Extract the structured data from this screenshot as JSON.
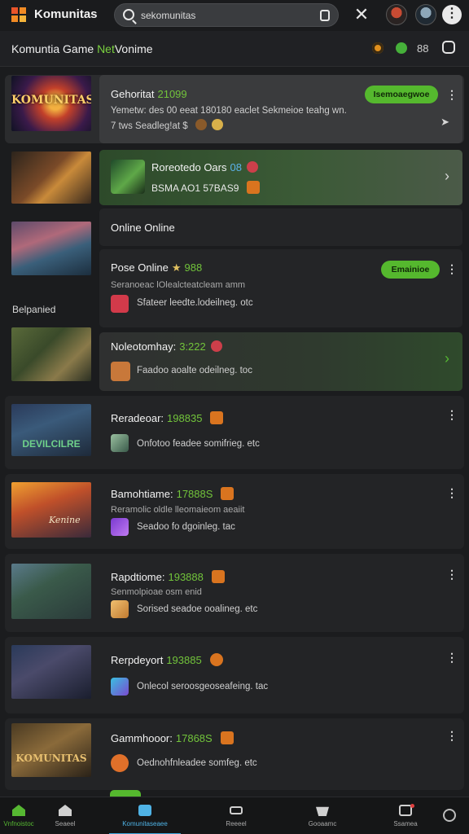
{
  "header": {
    "app_title": "Komunitas",
    "search_value": "sekomunitas",
    "search_placeholder": "Search"
  },
  "subheader": {
    "title_main": "Komuntia Game ",
    "title_accent": "Net",
    "title_rest": "Vonime",
    "count": "88"
  },
  "section_label": "Belpanied",
  "items": [
    {
      "title": "Gehoritat",
      "number": "21099",
      "line1": "Yemetw: des 00 eeat 180180 eaclet Sekmeioe teahg wn.",
      "line2": "7 tws Seadleg!at $ ",
      "thumb_text": "KOMUNITAS",
      "button": "Isemoaegwoe"
    },
    {
      "title": "Roreotedo Oars",
      "number": "08",
      "line1": "BSMA AO1 57BAS9"
    },
    {
      "title": "Online Online"
    },
    {
      "title": "Pose Online",
      "number": "988",
      "line1": "Seranoeac lOlealcteatcleam amm",
      "line2": "Sfateer leedte.lodeilneg. otc",
      "button": "Emainioe"
    },
    {
      "title": "Noleotomhay:",
      "number": "3:222",
      "line1": "Faadoo aoalte odeilneg. toc"
    },
    {
      "title": "Reradeoar:",
      "number": "198835",
      "line1": "Onfotoo feadee somifrieg. etc",
      "thumb_text": "DEVILCILRE"
    },
    {
      "title": "Bamohtiame:",
      "number": "17888S",
      "line1": "Reramolic oldle lleomaieom aeaiit",
      "line2": "Seadoo fo   dgoinleg. tac",
      "thumb_text": "Kenine"
    },
    {
      "title": "Rapdtiome:",
      "number": "193888",
      "line1": "Senmolpioae osm enid",
      "line2": "Sorised seadoe ooalineg. etc"
    },
    {
      "title": "Rerpdeyort",
      "number": "193885",
      "line1": "Onlecol seroosgeoseafeing. tac"
    },
    {
      "title": "Gammhooor:",
      "number": "17868S",
      "line1": "Oednohfnleadee somfeg. etc",
      "thumb_text": "KOMUNITAS"
    }
  ],
  "nav": [
    {
      "label": "Vnfnoistoc"
    },
    {
      "label": "Seaeel"
    },
    {
      "label": "Komunitaseaee"
    },
    {
      "label": "Reeeel"
    },
    {
      "label": "Gooaamc"
    },
    {
      "label": "Ssamea"
    },
    {
      "label": ""
    }
  ],
  "colors": {
    "accent_green": "#55b82e",
    "number_green": "#72c43b",
    "active_blue": "#3aa6dc",
    "badge_orange": "#d9741f"
  }
}
